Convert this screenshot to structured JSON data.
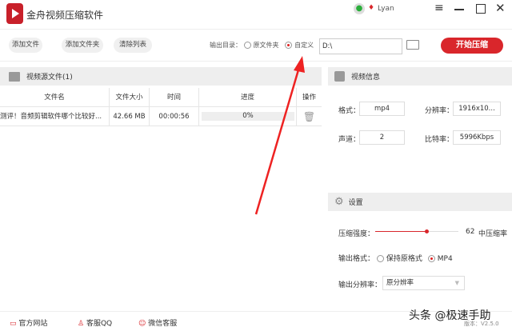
{
  "app": {
    "title": "金舟视频压缩软件",
    "user": "Lyan"
  },
  "toolbar": {
    "add_file": "添加文件",
    "add_folder": "添加文件夹",
    "clear_list": "清除列表",
    "output_dir_label": "输出目录：",
    "opt_source": "原文件夹",
    "opt_custom": "自定义",
    "path": "D:\\",
    "start": "开始压缩"
  },
  "files": {
    "header": "视频源文件(1)",
    "columns": [
      "文件名",
      "文件大小",
      "时间",
      "进度",
      "操作"
    ],
    "rows": [
      {
        "name": "测评！音频剪辑软件哪个比较好...",
        "size": "42.66 MB",
        "time": "00:00:56",
        "progress": "0%",
        "progress_value": 0
      }
    ]
  },
  "info": {
    "header": "视频信息",
    "format_label": "格式：",
    "format": "mp4",
    "resolution_label": "分辨率：",
    "resolution": "1916x10...",
    "channels_label": "声道：",
    "channels": "2",
    "bitrate_label": "比特率：",
    "bitrate": "5996Kbps"
  },
  "settings": {
    "header": "设置",
    "strength_label": "压缩强度：",
    "strength": 62,
    "strength_text": "62",
    "strength_mode": "中压缩率",
    "format_label": "输出格式：",
    "opt_keep": "保持原格式",
    "opt_mp4": "MP4",
    "res_label": "输出分辨率：",
    "res_value": "原分辨率"
  },
  "footer": {
    "website": "官方网站",
    "qq": "客服QQ",
    "wechat": "微信客服",
    "version": "版本：V2.5.0"
  },
  "watermark": "头条 @极速手助",
  "colors": {
    "accent": "#d9262b"
  }
}
